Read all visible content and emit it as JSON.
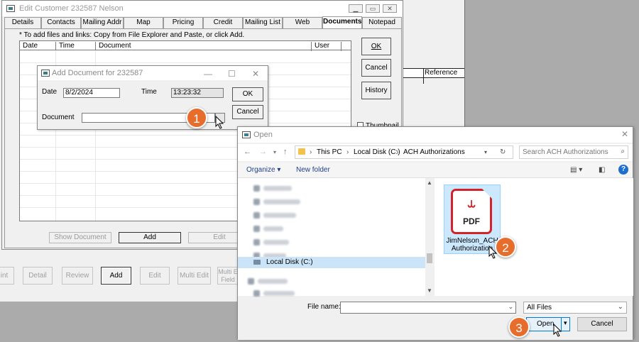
{
  "background": {
    "table_header": "Reference",
    "buttons": [
      "int",
      "Detail",
      "Review",
      "Add",
      "Edit",
      "Multi Edit",
      "Multi E Field"
    ]
  },
  "edit_customer": {
    "title": "Edit Customer 232587 Nelson",
    "tabs": [
      "Details",
      "Contacts",
      "Mailing Addr",
      "Map",
      "Pricing",
      "Credit",
      "Mailing List",
      "Web",
      "Documents",
      "Notepad"
    ],
    "selected_tab": "Documents",
    "hint": "* To add files and links: Copy from File Explorer and Paste, or click Add.",
    "columns": [
      "Date",
      "Time",
      "Document",
      "User"
    ],
    "side_buttons": [
      "OK",
      "Cancel",
      "History"
    ],
    "thumbnail_label": "Thumbnail",
    "bottom_buttons": [
      "Show Document",
      "Add",
      "Edit"
    ]
  },
  "add_document": {
    "title": "Add Document for  232587",
    "date_label": "Date",
    "date_value": "8/2/2024",
    "time_label": "Time",
    "time_value": "13:23:32",
    "document_label": "Document",
    "document_value": "",
    "ok_label": "OK",
    "cancel_label": "Cancel"
  },
  "open_dialog": {
    "title": "Open",
    "breadcrumb": [
      "This PC",
      "Local Disk (C:)",
      "ACH Authorizations"
    ],
    "search_placeholder": "Search ACH Authorizations",
    "organize_label": "Organize",
    "new_folder_label": "New folder",
    "nav_selected": "Local Disk (C:)",
    "file": {
      "name": "JimNelson_ACH Authorization",
      "type_label": "PDF"
    },
    "file_name_label": "File name:",
    "file_name_value": "",
    "file_type_filter": "All Files",
    "open_label": "Open",
    "cancel_label": "Cancel"
  },
  "steps": [
    "1",
    "2",
    "3"
  ],
  "colors": {
    "badge": "#e66d2b",
    "pdf_red": "#d3222a",
    "selection": "#cce8ff",
    "accent": "#0078d7"
  }
}
